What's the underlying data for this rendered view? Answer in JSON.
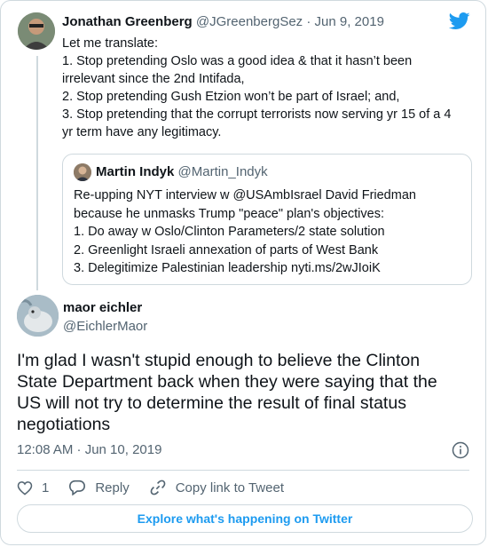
{
  "colors": {
    "accent": "#1d9bf0",
    "muted": "#536471",
    "border": "#cfd9de",
    "text": "#0f1419"
  },
  "parent_tweet": {
    "author_name": "Jonathan Greenberg",
    "author_handle": "@JGreenbergSez",
    "date": "· Jun 9, 2019",
    "lines": [
      "Let me translate:",
      "1. Stop pretending Oslo was a good idea & that it hasn’t been",
      "irrelevant since the 2nd Intifada,",
      "2. Stop pretending Gush Etzion won’t be part of Israel; and,",
      "3. Stop pretending that the corrupt terrorists now serving yr 15 of a 4",
      "yr term have any legitimacy."
    ]
  },
  "quoted_tweet": {
    "author_name": "Martin Indyk",
    "author_handle": "@Martin_Indyk",
    "lines": [
      "Re-upping NYT interview w @USAmbIsrael David Friedman",
      "because he unmasks Trump \"peace\" plan's objectives:",
      "1. Do away w Oslo/Clinton Parameters/2 state solution",
      "2. Greenlight Israeli annexation of parts of West Bank",
      "3. Delegitimize Palestinian leadership nyti.ms/2wJIoiK"
    ]
  },
  "main_tweet": {
    "author_name": "maor eichler",
    "author_handle": "@EichlerMaor",
    "lines": [
      "I'm glad I wasn't stupid enough to believe the Clinton",
      "State Department back when they were saying that the",
      "US will not try to determine the result of final status",
      "negotiations"
    ],
    "timestamp": "12:08 AM · Jun 10, 2019"
  },
  "actions": {
    "like_count": "1",
    "reply_label": "Reply",
    "copy_link_label": "Copy link to Tweet"
  },
  "explore_label": "Explore what's happening on Twitter",
  "icons": [
    "twitter-bird-icon",
    "info-icon",
    "heart-icon",
    "reply-icon",
    "link-icon"
  ]
}
